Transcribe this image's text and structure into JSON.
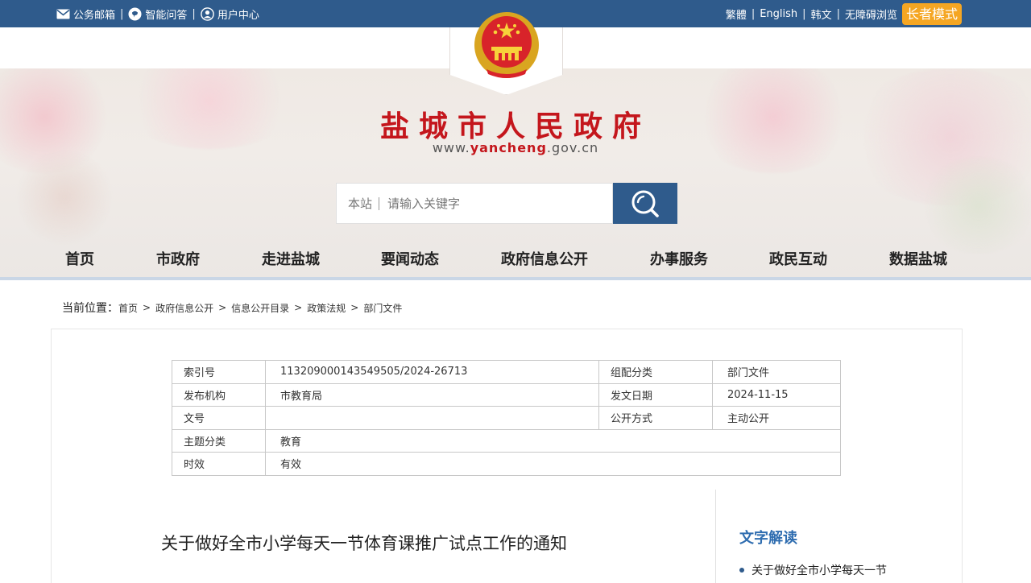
{
  "topbar": {
    "left": [
      {
        "icon": "mail-icon",
        "label": "公务邮箱"
      },
      {
        "icon": "chat-icon",
        "label": "智能问答"
      },
      {
        "icon": "user-icon",
        "label": "用户中心"
      }
    ],
    "separator": "|",
    "right": [
      "繁體",
      "English",
      "韩文",
      "无障碍浏览"
    ],
    "elder_mode": "长者模式"
  },
  "site": {
    "title": "盐城市人民政府",
    "url_prefix": "www.",
    "url_highlight": "yancheng",
    "url_suffix": ".gov.cn"
  },
  "search": {
    "scope": "本站",
    "placeholder": "请输入关键字",
    "button_icon": "search-icon"
  },
  "nav": [
    "首页",
    "市政府",
    "走进盐城",
    "要闻动态",
    "政府信息公开",
    "办事服务",
    "政民互动",
    "数据盐城"
  ],
  "breadcrumb": {
    "label": "当前位置：",
    "items": [
      "首页",
      "政府信息公开",
      "信息公开目录",
      "政策法规",
      "部门文件"
    ],
    "arrow": ">"
  },
  "meta": {
    "index_label": "索引号",
    "index_value": "113209000143549505/2024-26713",
    "category_label": "组配分类",
    "category_value": "部门文件",
    "issuer_label": "发布机构",
    "issuer_value": "市教育局",
    "date_label": "发文日期",
    "date_value": "2024-11-15",
    "docno_label": "文号",
    "docno_value": "",
    "public_label": "公开方式",
    "public_value": "主动公开",
    "topic_label": "主题分类",
    "topic_value": "教育",
    "validity_label": "时效",
    "validity_value": "有效"
  },
  "document": {
    "title": "关于做好全市小学每天一节体育课推广试点工作的通知"
  },
  "sidebar": {
    "heading": "文字解读",
    "items": [
      "关于做好全市小学每天一节"
    ]
  },
  "colors": {
    "brand_blue": "#2f5b8c",
    "title_red": "#c4161c",
    "elder_orange": "#f5a623",
    "side_head_blue": "#2f6db0"
  }
}
